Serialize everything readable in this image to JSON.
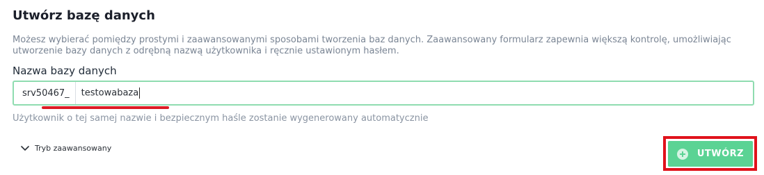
{
  "page": {
    "title": "Utwórz bazę danych",
    "description": "Możesz wybierać pomiędzy prostymi i zaawansowanymi sposobami tworzenia baz danych. Zaawansowany formularz zapewnia większą kontrolę, umożliwiając utworzenie bazy danych z odrębną nazwą użytkownika i ręcznie ustawionym hasłem."
  },
  "form": {
    "db_name_label": "Nazwa bazy danych",
    "db_prefix": "srv50467_",
    "db_name_value": "testowabaza",
    "hint": "Użytkownik o tej samej nazwie i bezpiecznym haśle zostanie wygenerowany automatycznie"
  },
  "advanced": {
    "label": "Tryb zaawansowany",
    "icon": "chevron-down-icon"
  },
  "actions": {
    "create_label": "UTWÓRZ",
    "create_icon": "plus-circle-icon"
  },
  "colors": {
    "accent_green": "#5bd394",
    "input_border": "#8fdcb0",
    "highlight_red": "#e0121b"
  }
}
